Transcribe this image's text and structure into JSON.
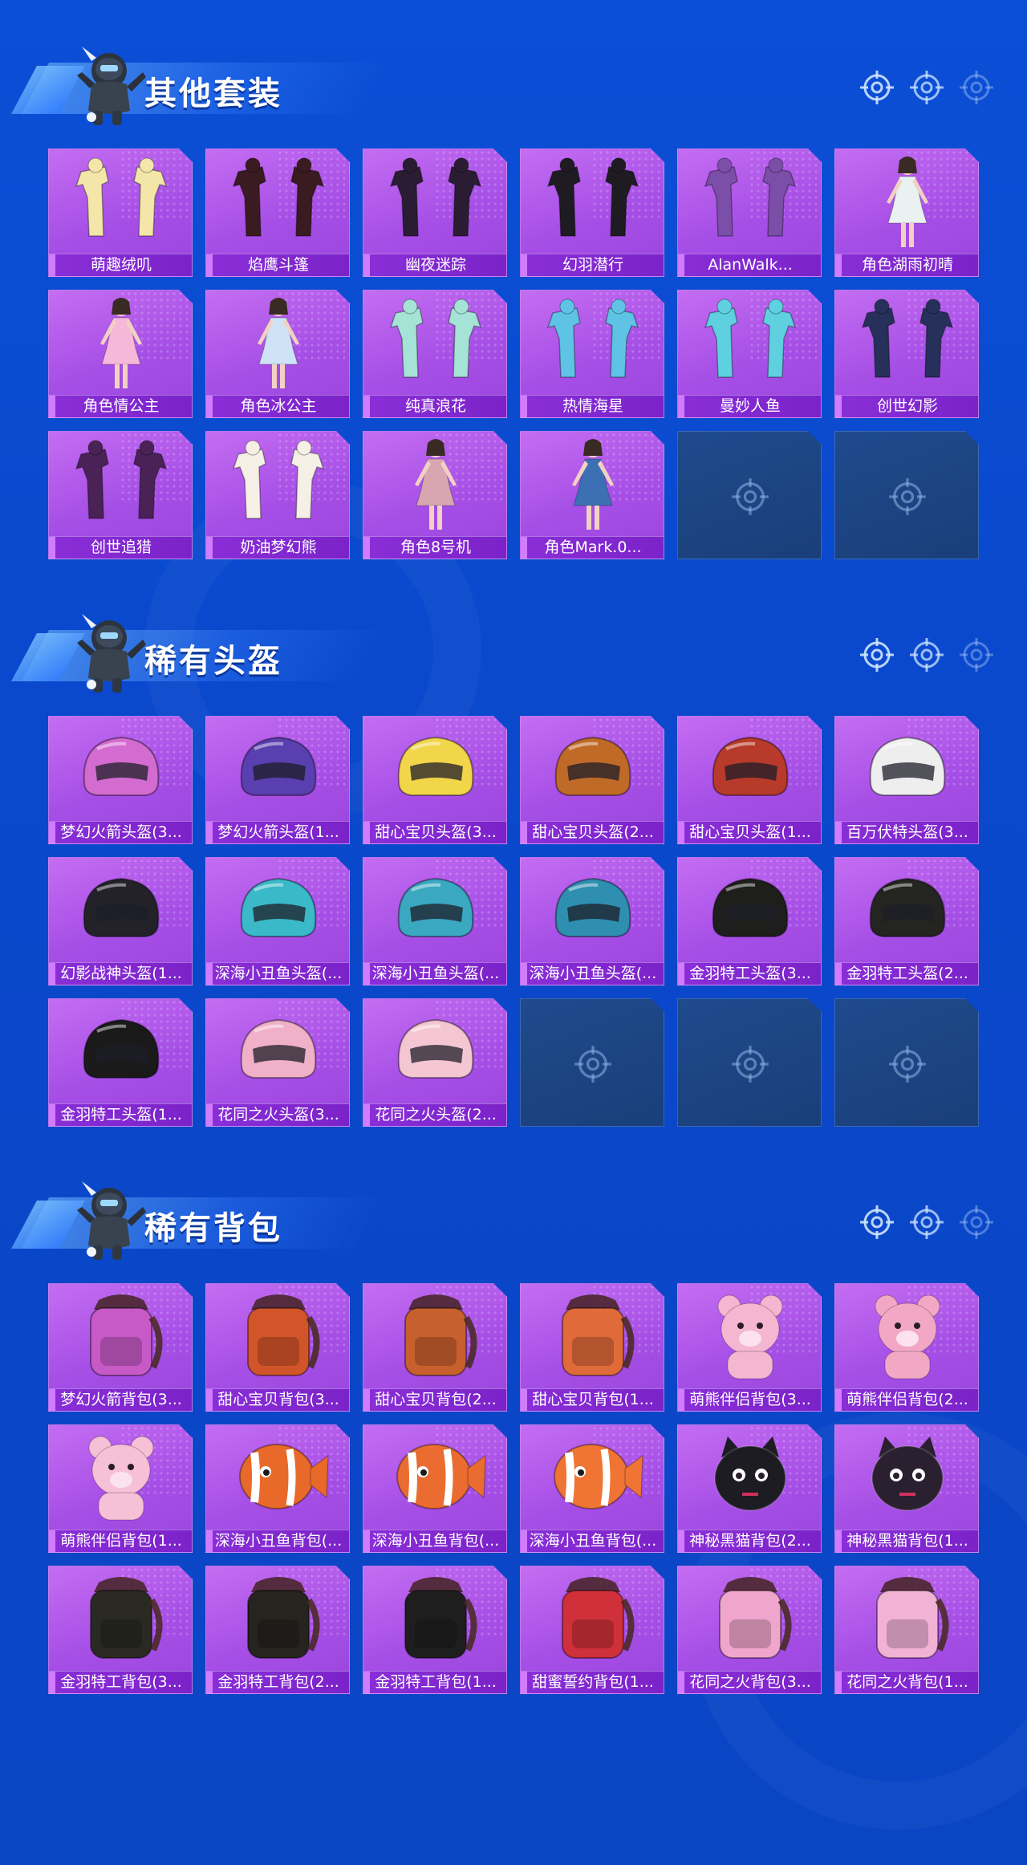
{
  "colors": {
    "background": "#0b4fd6",
    "card": "#b25ee9",
    "card_label_bar": "#8a2fd8",
    "empty_slot": "#1f4a8c"
  },
  "icons": {
    "mascot": "skydiving-character-icon",
    "section_marker": "crosshair-icon",
    "empty_slot": "crosshair-icon"
  },
  "sections": [
    {
      "title": "其他套装",
      "items": [
        {
          "label": "萌趣绒叽",
          "kind": "outfit",
          "color": "#f3e6a8"
        },
        {
          "label": "焰鹰斗篷",
          "kind": "outfit",
          "color": "#3a1b22"
        },
        {
          "label": "幽夜迷踪",
          "kind": "outfit",
          "color": "#2a1c33"
        },
        {
          "label": "幻羽潜行",
          "kind": "outfit",
          "color": "#1e1b22"
        },
        {
          "label": "AlanWalk...",
          "kind": "outfit",
          "color": "#7b4ea8"
        },
        {
          "label": "角色湖雨初晴",
          "kind": "figure",
          "color": "#e9f2f0"
        },
        {
          "label": "角色情公主",
          "kind": "figure",
          "color": "#f6b8d8"
        },
        {
          "label": "角色冰公主",
          "kind": "figure",
          "color": "#cfe3f7"
        },
        {
          "label": "纯真浪花",
          "kind": "outfit",
          "color": "#a5e3d6"
        },
        {
          "label": "热情海星",
          "kind": "outfit",
          "color": "#5fc3e6"
        },
        {
          "label": "曼妙人鱼",
          "kind": "outfit",
          "color": "#5fd0e0"
        },
        {
          "label": "创世幻影",
          "kind": "outfit",
          "color": "#26305a"
        },
        {
          "label": "创世追猎",
          "kind": "outfit",
          "color": "#4a2256"
        },
        {
          "label": "奶油梦幻熊",
          "kind": "outfit",
          "color": "#f5efe6"
        },
        {
          "label": "角色8号机",
          "kind": "figure",
          "color": "#d7a6b0"
        },
        {
          "label": "角色Mark.0...",
          "kind": "figure",
          "color": "#3d6fb5"
        }
      ]
    },
    {
      "title": "稀有头盔",
      "items": [
        {
          "label": "梦幻火箭头盔(3...",
          "kind": "helmet",
          "color": "#d46bd0"
        },
        {
          "label": "梦幻火箭头盔(1...",
          "kind": "helmet",
          "color": "#5a3fb0"
        },
        {
          "label": "甜心宝贝头盔(3...",
          "kind": "helmet",
          "color": "#f2d64a"
        },
        {
          "label": "甜心宝贝头盔(2...",
          "kind": "helmet",
          "color": "#c06a28"
        },
        {
          "label": "甜心宝贝头盔(1...",
          "kind": "helmet",
          "color": "#b83a2a"
        },
        {
          "label": "百万伏特头盔(3...",
          "kind": "helmet",
          "color": "#eeeeee"
        },
        {
          "label": "幻影战神头盔(1...",
          "kind": "helmet",
          "color": "#222228"
        },
        {
          "label": "深海小丑鱼头盔(...",
          "kind": "helmet",
          "color": "#3ab9c8"
        },
        {
          "label": "深海小丑鱼头盔(...",
          "kind": "helmet",
          "color": "#3aa8c0"
        },
        {
          "label": "深海小丑鱼头盔(...",
          "kind": "helmet",
          "color": "#2f8fb0"
        },
        {
          "label": "金羽特工头盔(3...",
          "kind": "helmet",
          "color": "#1e1e1c"
        },
        {
          "label": "金羽特工头盔(2...",
          "kind": "helmet",
          "color": "#242420"
        },
        {
          "label": "金羽特工头盔(1...",
          "kind": "helmet",
          "color": "#1a1a1a"
        },
        {
          "label": "花同之火头盔(3...",
          "kind": "helmet",
          "color": "#f0b0c8"
        },
        {
          "label": "花同之火头盔(2...",
          "kind": "helmet",
          "color": "#f4c6d2"
        }
      ]
    },
    {
      "title": "稀有背包",
      "items": [
        {
          "label": "梦幻火箭背包(3...",
          "kind": "backpack",
          "color": "#c85ac8"
        },
        {
          "label": "甜心宝贝背包(3...",
          "kind": "backpack",
          "color": "#d2552a"
        },
        {
          "label": "甜心宝贝背包(2...",
          "kind": "backpack",
          "color": "#c8602e"
        },
        {
          "label": "甜心宝贝背包(1...",
          "kind": "backpack",
          "color": "#e06a3a"
        },
        {
          "label": "萌熊伴侣背包(3...",
          "kind": "bear",
          "color": "#f4b6d0"
        },
        {
          "label": "萌熊伴侣背包(2...",
          "kind": "bear",
          "color": "#f2a8c4"
        },
        {
          "label": "萌熊伴侣背包(1...",
          "kind": "bear",
          "color": "#f6c0d6"
        },
        {
          "label": "深海小丑鱼背包(...",
          "kind": "fish",
          "color": "#e8692a"
        },
        {
          "label": "深海小丑鱼背包(...",
          "kind": "fish",
          "color": "#ea6c30"
        },
        {
          "label": "深海小丑鱼背包(...",
          "kind": "fish",
          "color": "#f07434"
        },
        {
          "label": "神秘黑猫背包(2...",
          "kind": "cat",
          "color": "#1c1c22"
        },
        {
          "label": "神秘黑猫背包(1...",
          "kind": "cat",
          "color": "#2a2030"
        },
        {
          "label": "金羽特工背包(3...",
          "kind": "backpack",
          "color": "#2a2a22"
        },
        {
          "label": "金羽特工背包(2...",
          "kind": "backpack",
          "color": "#25241e"
        },
        {
          "label": "金羽特工背包(1...",
          "kind": "backpack",
          "color": "#1e1e1e"
        },
        {
          "label": "甜蜜誓约背包(1...",
          "kind": "backpack",
          "color": "#d0303a"
        },
        {
          "label": "花同之火背包(3...",
          "kind": "backpack",
          "color": "#f0a6cc"
        },
        {
          "label": "花同之火背包(1...",
          "kind": "backpack",
          "color": "#f2b2d6"
        }
      ]
    }
  ]
}
